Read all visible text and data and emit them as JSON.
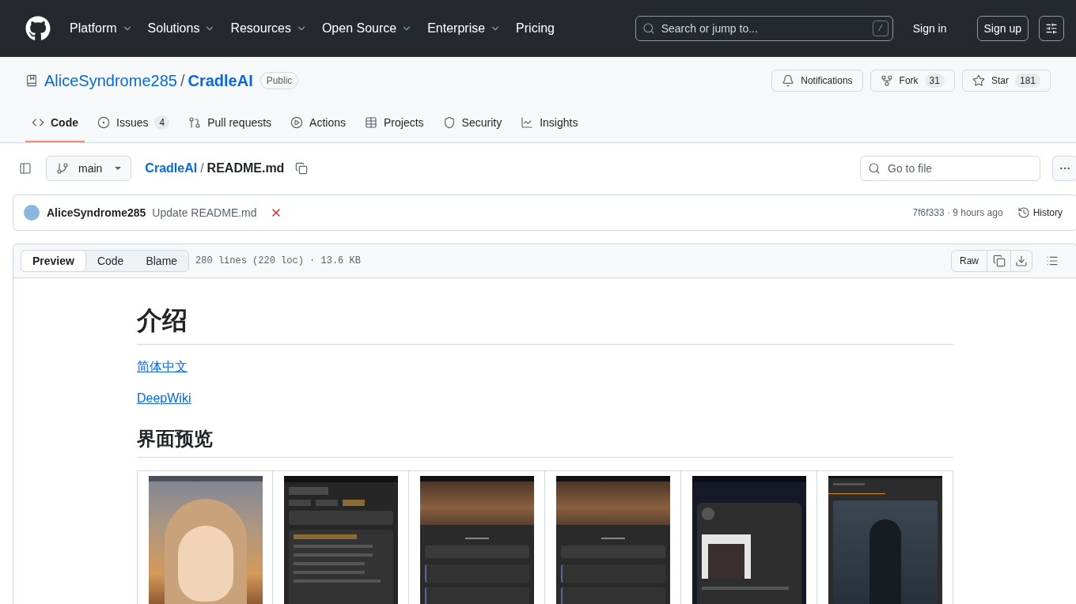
{
  "header": {
    "nav": [
      {
        "label": "Platform",
        "dropdown": true
      },
      {
        "label": "Solutions",
        "dropdown": true
      },
      {
        "label": "Resources",
        "dropdown": true
      },
      {
        "label": "Open Source",
        "dropdown": true
      },
      {
        "label": "Enterprise",
        "dropdown": true
      },
      {
        "label": "Pricing",
        "dropdown": false
      }
    ],
    "search": {
      "placeholder": "Search or jump to...",
      "shortcut": "/"
    },
    "sign_in": "Sign in",
    "sign_up": "Sign up"
  },
  "repo": {
    "owner": "AliceSyndrome285",
    "separator": "/",
    "name": "CradleAI",
    "visibility": "Public",
    "actions": [
      {
        "kind": "notifications",
        "label": "Notifications"
      },
      {
        "kind": "fork",
        "label": "Fork",
        "count": "31"
      },
      {
        "kind": "star",
        "label": "Star",
        "count": "181"
      }
    ]
  },
  "tabs": [
    {
      "kind": "code",
      "label": "Code",
      "selected": true
    },
    {
      "kind": "issues",
      "label": "Issues",
      "count": "4",
      "selected": false
    },
    {
      "kind": "pulls",
      "label": "Pull requests",
      "selected": false
    },
    {
      "kind": "actions",
      "label": "Actions",
      "selected": false
    },
    {
      "kind": "projects",
      "label": "Projects",
      "selected": false
    },
    {
      "kind": "security",
      "label": "Security",
      "selected": false
    },
    {
      "kind": "insights",
      "label": "Insights",
      "selected": false
    }
  ],
  "file_nav": {
    "branch": "main",
    "path": [
      "CradleAI",
      "README.md"
    ],
    "path_separator": "/",
    "go_to_file": {
      "placeholder": "Go to file"
    }
  },
  "commit": {
    "author": "AliceSyndrome285",
    "message": "Update README.md",
    "checks_failed": true,
    "info": "7f6f333 · 9 hours ago",
    "history": "History"
  },
  "file": {
    "views": [
      {
        "label": "Preview",
        "selected": true
      },
      {
        "label": "Code",
        "selected": false
      },
      {
        "label": "Blame",
        "selected": false
      }
    ],
    "info": "280 lines (220 loc) · 13.6 KB",
    "raw": "Raw"
  },
  "readme": [
    {
      "kind": "h1",
      "text": "介绍"
    },
    {
      "kind": "link",
      "text": "简体中文"
    },
    {
      "kind": "link",
      "text": "DeepWiki"
    },
    {
      "kind": "h2",
      "text": "界面预览"
    },
    {
      "kind": "screenshots",
      "items": [
        {
          "kind": "portrait"
        },
        {
          "kind": "memory-panel"
        },
        {
          "kind": "profile"
        },
        {
          "kind": "profile"
        },
        {
          "kind": "feed"
        },
        {
          "kind": "image-gen"
        }
      ]
    }
  ]
}
